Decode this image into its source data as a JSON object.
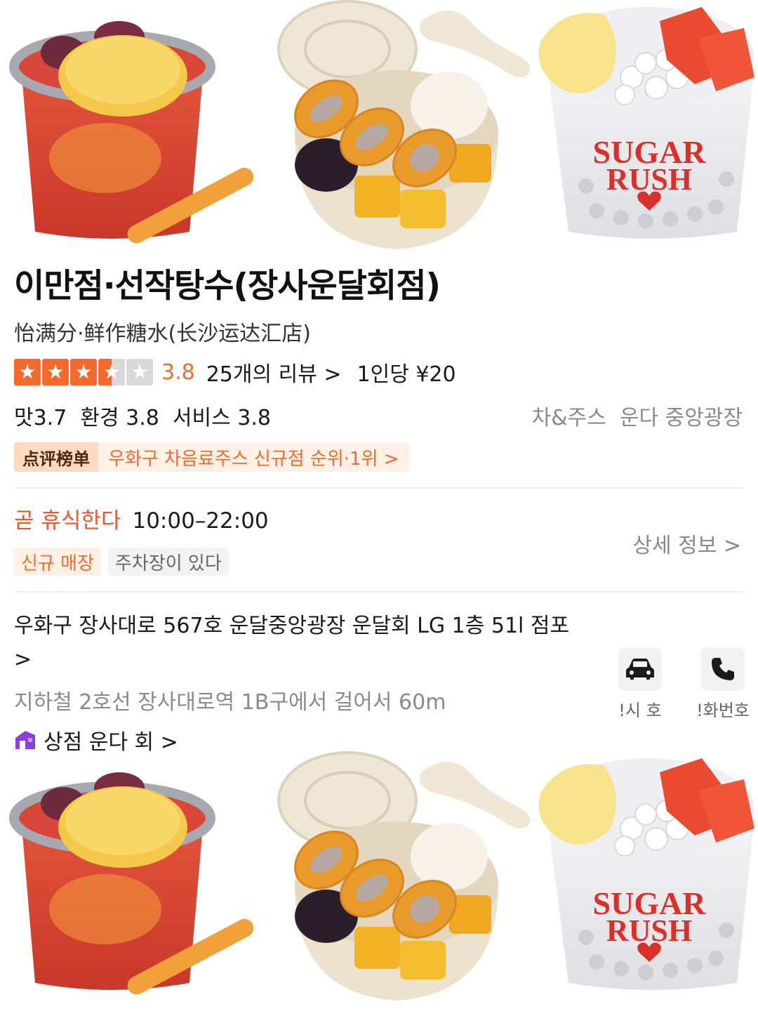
{
  "store": {
    "name_ko": "이만점·선작탕수(장사운달회점)",
    "name_zh": "怡满分·鲜作糖水(长沙运达汇店)",
    "rating": "3.8",
    "rating_stars": 3.5,
    "reviews": "25개의 리뷰 >",
    "price": "1인당 ¥20",
    "subscores": "맛3.7  환경 3.8  서비스 3.8",
    "category": "차&주스  운다 중앙광장",
    "rank_tag": "点评榜单",
    "rank_text": "우화구 차음료주스 신규점 순위·1위 >"
  },
  "hours": {
    "status": "곧 휴식한다",
    "time": "10:00–22:00",
    "detail_link": "상세 정보 >"
  },
  "tags": [
    "신규 매장",
    "주차장이 있다"
  ],
  "location": {
    "address": "우화구 장사대로 567호 운달중앙광장 운달회 LG 1층 51l 점포 >",
    "metro": "지하철 2호선 장사대로역 1B구에서 걸어서 60m",
    "shop_link": "상점 운다 회 >"
  },
  "actions": {
    "taxi_label": "!시 호",
    "phone_label": "!화번호"
  },
  "banner": {
    "cup_text_line1": "SUGAR",
    "cup_text_line2": "RUSH"
  },
  "icons": [
    "star-icon",
    "car-icon",
    "phone-icon",
    "shop-icon"
  ],
  "colors": {
    "accent": "#f36a2c",
    "closing": "#f2552c",
    "muted": "#8a8a8a"
  }
}
